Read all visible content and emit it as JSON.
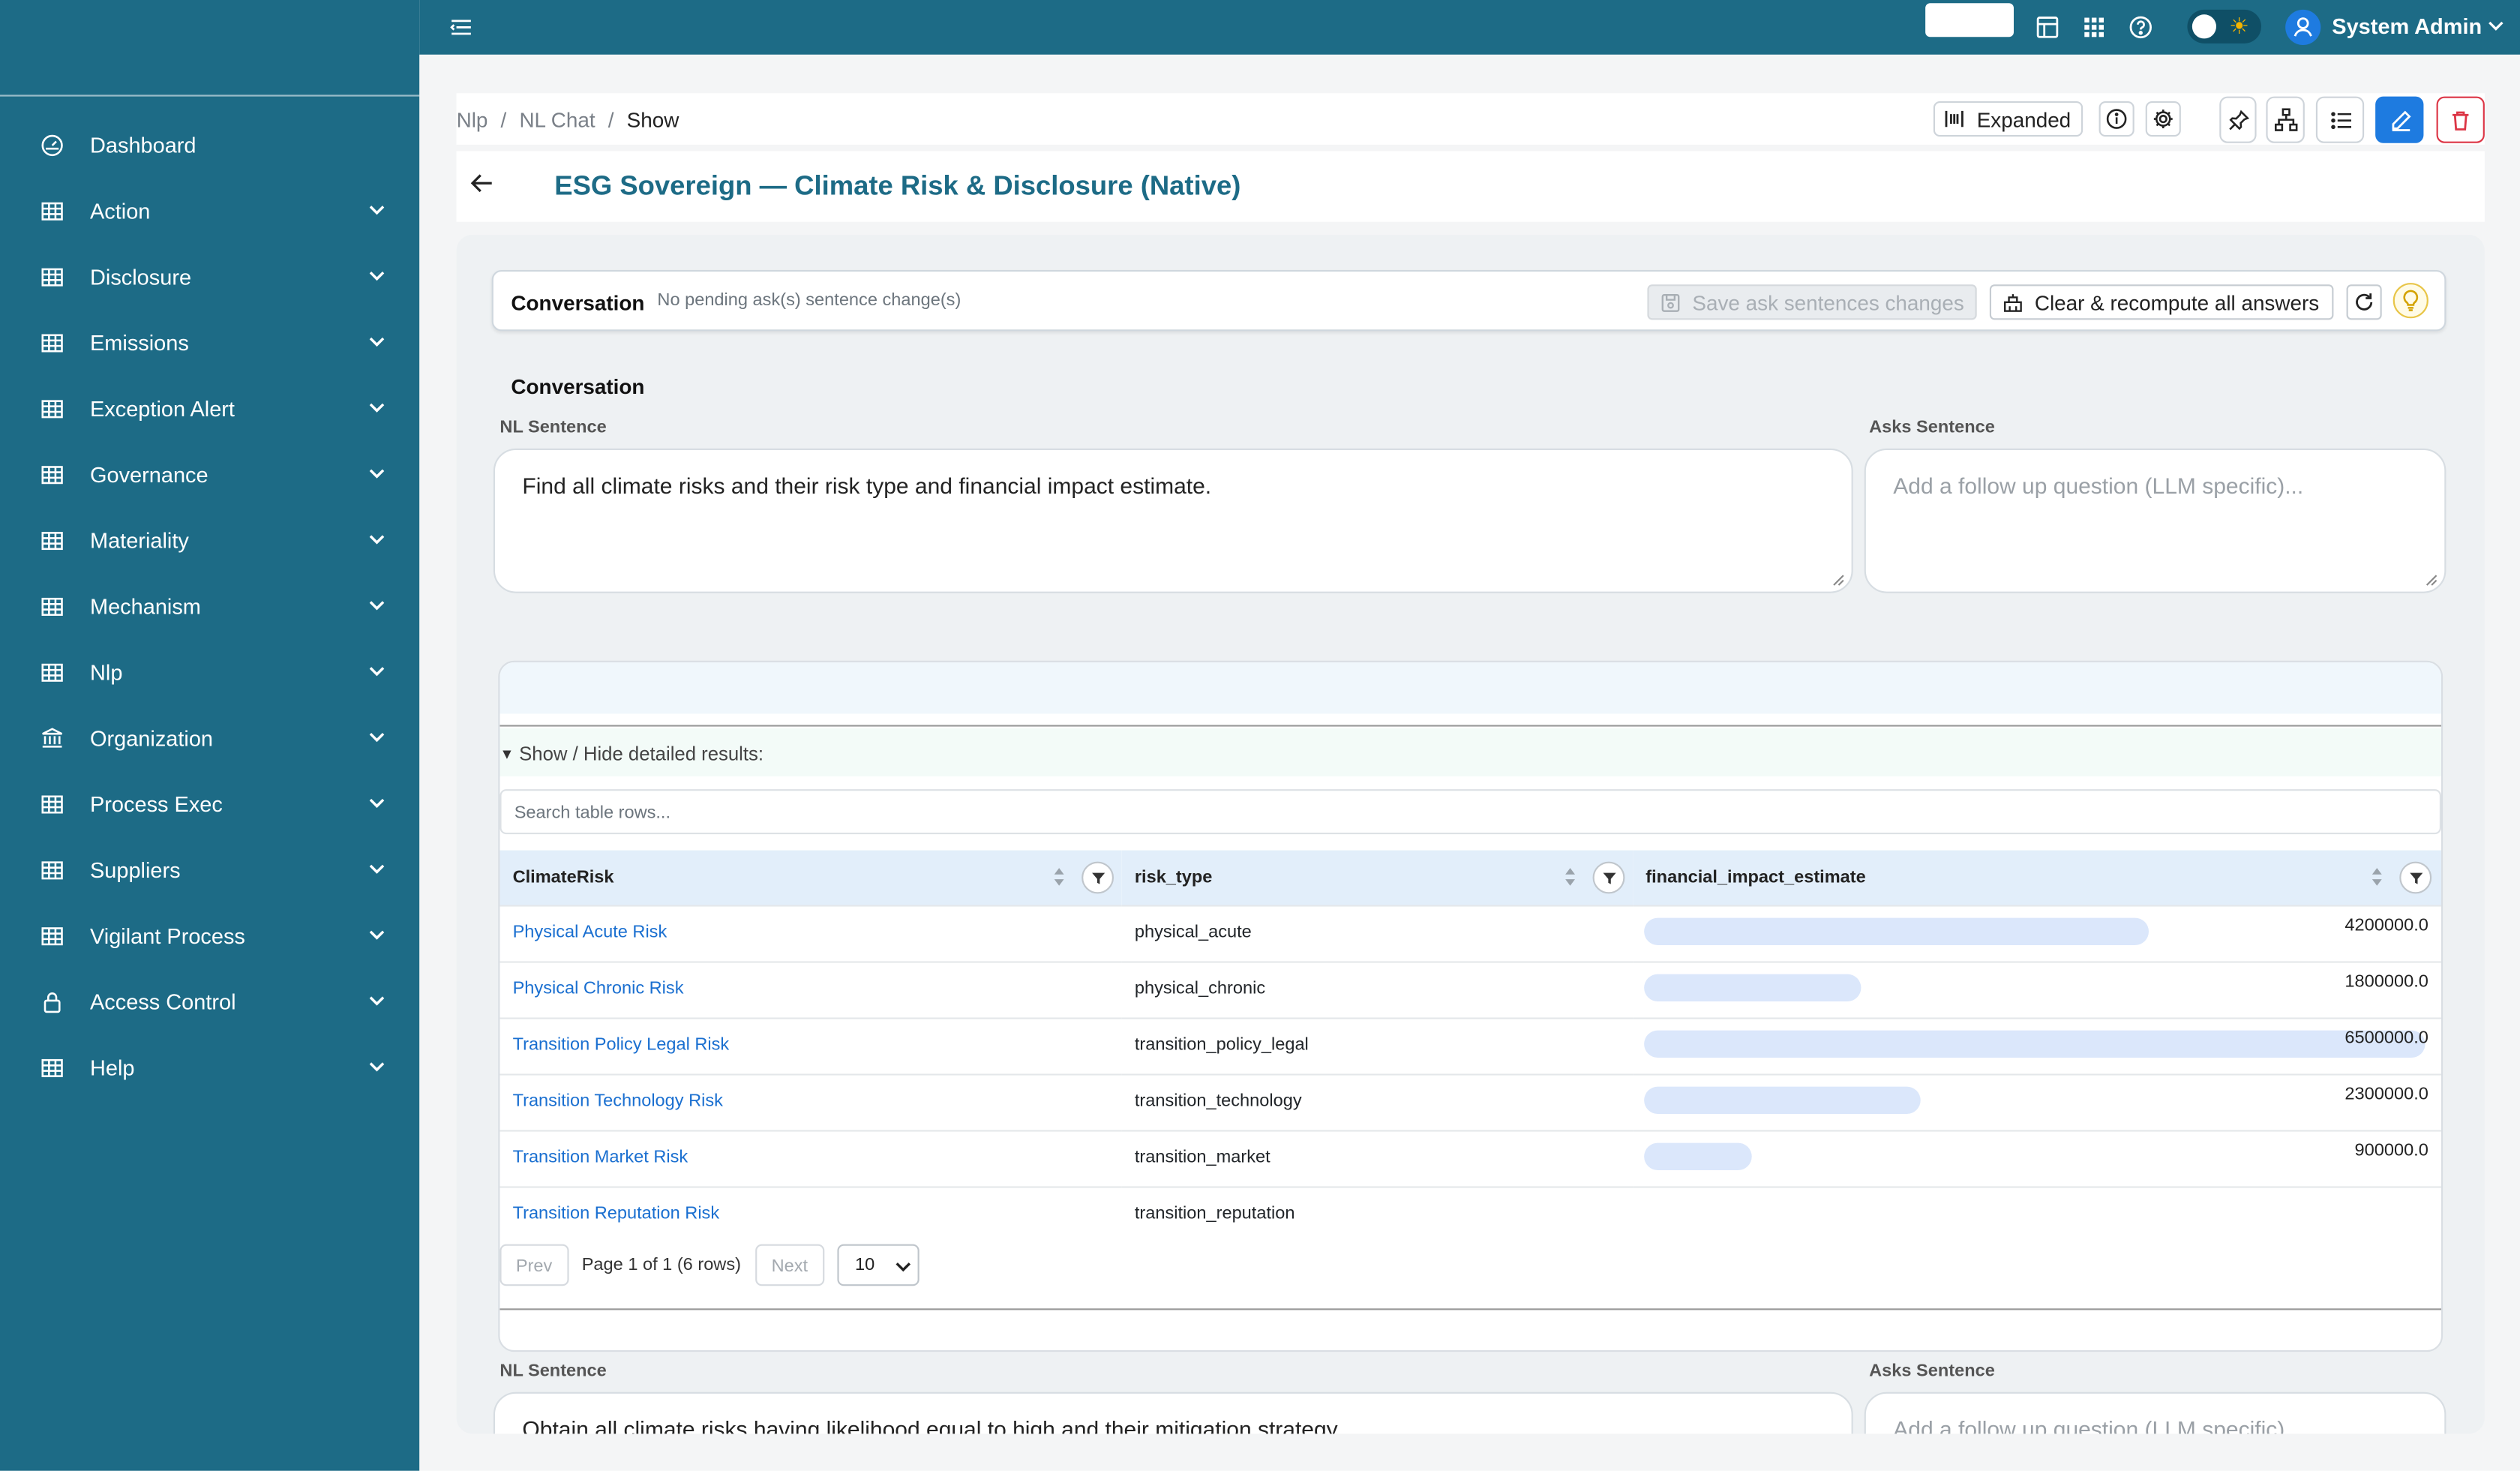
{
  "topbar": {
    "user_name": "System Admin",
    "icons": [
      "menu-icon",
      "layout-icon",
      "grid-icon",
      "help-icon",
      "sun-icon",
      "user-icon"
    ]
  },
  "sidebar": {
    "items": [
      {
        "label": "Dashboard",
        "icon": "dashboard-icon",
        "has_children": false
      },
      {
        "label": "Action",
        "icon": "table-icon",
        "has_children": true
      },
      {
        "label": "Disclosure",
        "icon": "table-icon",
        "has_children": true
      },
      {
        "label": "Emissions",
        "icon": "table-icon",
        "has_children": true
      },
      {
        "label": "Exception Alert",
        "icon": "table-icon",
        "has_children": true
      },
      {
        "label": "Governance",
        "icon": "table-icon",
        "has_children": true
      },
      {
        "label": "Materiality",
        "icon": "table-icon",
        "has_children": true
      },
      {
        "label": "Mechanism",
        "icon": "table-icon",
        "has_children": true
      },
      {
        "label": "Nlp",
        "icon": "table-icon",
        "has_children": true
      },
      {
        "label": "Organization",
        "icon": "bank-icon",
        "has_children": true
      },
      {
        "label": "Process Exec",
        "icon": "table-icon",
        "has_children": true
      },
      {
        "label": "Suppliers",
        "icon": "table-icon",
        "has_children": true
      },
      {
        "label": "Vigilant Process",
        "icon": "table-icon",
        "has_children": true
      },
      {
        "label": "Access Control",
        "icon": "lock-icon",
        "has_children": true
      },
      {
        "label": "Help",
        "icon": "table-icon",
        "has_children": true
      }
    ]
  },
  "breadcrumb": {
    "items": [
      "Nlp",
      "NL Chat",
      "Show"
    ],
    "separator": "/"
  },
  "toolbar": {
    "expanded_label": "Expanded"
  },
  "page": {
    "title": "ESG Sovereign — Climate Risk & Disclosure (Native)"
  },
  "conversation_bar": {
    "title": "Conversation",
    "pending_text": "No pending ask(s) sentence change(s)",
    "save_label": "Save ask sentences changes",
    "clear_label": "Clear & recompute all answers"
  },
  "conversation": {
    "section_title": "Conversation",
    "nl_label": "NL Sentence",
    "asks_label": "Asks Sentence",
    "entries": [
      {
        "nl_sentence": "Find all climate risks and their risk type and financial impact estimate.",
        "asks_placeholder": "Add a follow up question (LLM specific)..."
      },
      {
        "nl_sentence": "Obtain all climate risks having likelihood equal to high and their mitigation strategy.",
        "asks_placeholder": "Add a follow up question (LLM specific)..."
      }
    ]
  },
  "results": {
    "toggle_label": "Show / Hide detailed results:",
    "search_placeholder": "Search table rows...",
    "columns": [
      "ClimateRisk",
      "risk_type",
      "financial_impact_estimate"
    ],
    "max_value": 6500000.0,
    "rows": [
      {
        "name": "Physical Acute Risk",
        "risk_type": "physical_acute",
        "value": 4200000.0,
        "value_label": "4200000.0"
      },
      {
        "name": "Physical Chronic Risk",
        "risk_type": "physical_chronic",
        "value": 1800000.0,
        "value_label": "1800000.0"
      },
      {
        "name": "Transition Policy Legal Risk",
        "risk_type": "transition_policy_legal",
        "value": 6500000.0,
        "value_label": "6500000.0"
      },
      {
        "name": "Transition Technology Risk",
        "risk_type": "transition_technology",
        "value": 2300000.0,
        "value_label": "2300000.0"
      },
      {
        "name": "Transition Market Risk",
        "risk_type": "transition_market",
        "value": 900000.0,
        "value_label": "900000.0"
      },
      {
        "name": "Transition Reputation Risk",
        "risk_type": "transition_reputation",
        "value": null,
        "value_label": ""
      }
    ],
    "pager": {
      "prev_label": "Prev",
      "next_label": "Next",
      "info": "Page 1 of 1 (6 rows)",
      "page_size": "10"
    }
  },
  "colors": {
    "brand": "#1d6b86",
    "primary": "#1e7be0",
    "danger": "#dc3545",
    "link": "#1a6fd0",
    "bar": "#dbe7fb"
  }
}
